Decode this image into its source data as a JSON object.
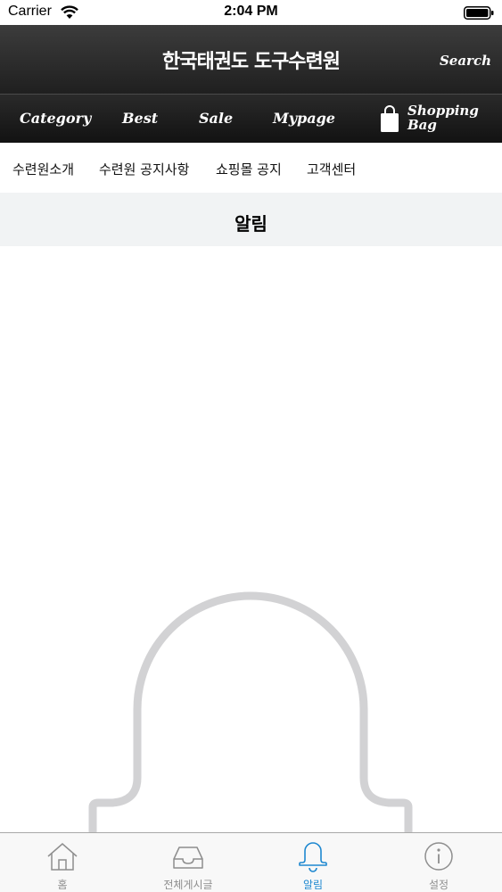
{
  "status_bar": {
    "carrier": "Carrier",
    "time": "2:04 PM"
  },
  "header": {
    "title": "한국태권도 도구수련원",
    "search_label": "Search"
  },
  "category_nav": {
    "items": [
      "Category",
      "Best",
      "Sale",
      "Mypage"
    ],
    "shopping_bag_line1": "Shopping",
    "shopping_bag_line2": "Bag"
  },
  "sub_nav": {
    "items": [
      "수련원소개",
      "수련원 공지사항",
      "쇼핑몰 공지",
      "고객센터"
    ]
  },
  "page": {
    "title": "알림"
  },
  "tab_bar": {
    "items": [
      {
        "label": "홈",
        "icon": "home-icon",
        "active": false
      },
      {
        "label": "전체게시글",
        "icon": "inbox-icon",
        "active": false
      },
      {
        "label": "알림",
        "icon": "bell-icon",
        "active": true
      },
      {
        "label": "설정",
        "icon": "info-icon",
        "active": false
      }
    ]
  },
  "colors": {
    "header_bg": "#2b2b2b",
    "active_tab": "#1e88d0",
    "inactive_tab": "#8e8e8e",
    "heading_bg": "#f1f3f4"
  }
}
